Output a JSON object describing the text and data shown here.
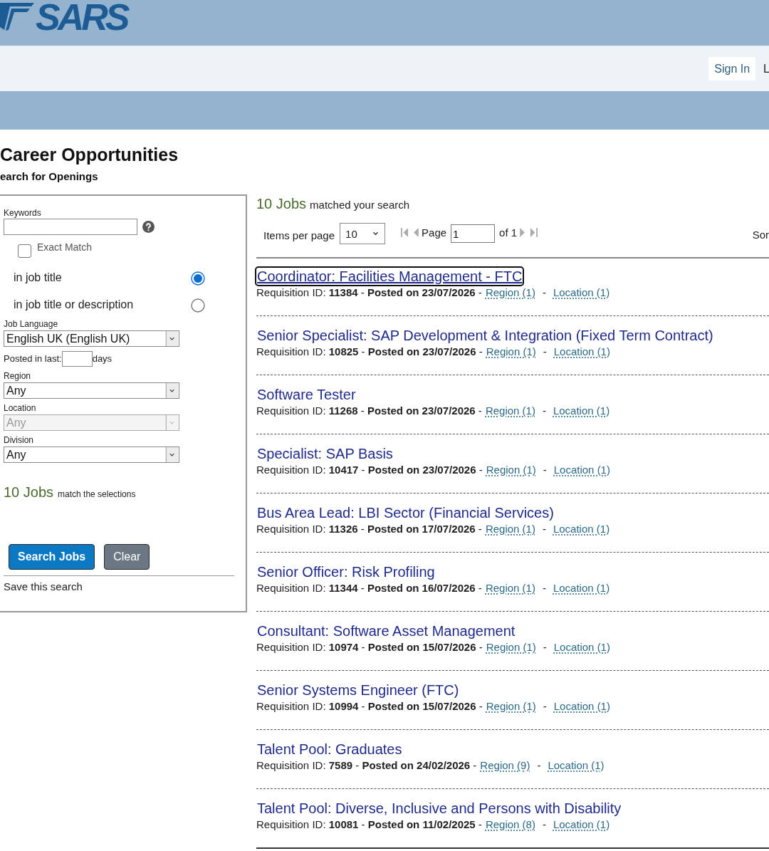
{
  "header": {
    "logo_text": "SARS"
  },
  "nav": {
    "sign_in": "Sign In",
    "cut_link": "L"
  },
  "page": {
    "title": "Career Opportunities",
    "subtitle": "earch for Openings"
  },
  "search_panel": {
    "keywords_label": "Keywords",
    "exact_match": {
      "label": "Exact Match",
      "checked": false
    },
    "scope_options": [
      {
        "label": "in job title",
        "selected": true
      },
      {
        "label": "in job title or description",
        "selected": false
      }
    ],
    "filters": [
      {
        "kind": "select",
        "label": "Job Language",
        "value": "English UK (English UK)",
        "disabled": false
      },
      {
        "kind": "days",
        "label": "Posted in last:",
        "unit": "days"
      },
      {
        "kind": "select",
        "label": "Region",
        "value": "Any",
        "disabled": false
      },
      {
        "kind": "select",
        "label": "Location",
        "value": "Any",
        "disabled": true
      },
      {
        "kind": "select",
        "label": "Division",
        "value": "Any",
        "disabled": false
      }
    ],
    "match": {
      "count": "10 Jobs",
      "text": "match the selections"
    },
    "buttons": [
      {
        "kind": "primary",
        "label": "Search Jobs"
      },
      {
        "kind": "secondary",
        "label": "Clear"
      }
    ],
    "save_link": "Save this search"
  },
  "results": {
    "count": "10 Jobs",
    "text": "matched your search",
    "pager": {
      "items_label": "Items per page",
      "items_value": "10",
      "page_label": "Page",
      "page_value": "1",
      "total_label": "of 1"
    },
    "sort_label": "Sor",
    "jobs": [
      {
        "title": "Coordinator: Facilities Management - FTC",
        "focused": true,
        "details": "Requisition ID: **11384** - **Posted on 23/07/2026** -",
        "region": "Region (1)",
        "separator": "-",
        "location": "Location (1)"
      },
      {
        "title": "Senior Specialist: SAP Development & Integration (Fixed Term Contract)",
        "focused": false,
        "details": "Requisition ID: **10825** - **Posted on 23/07/2026** -",
        "region": "Region (1)",
        "separator": "-",
        "location": "Location (1)"
      },
      {
        "title": "Software Tester",
        "focused": false,
        "details": "Requisition ID: **11268** - **Posted on 23/07/2026** -",
        "region": "Region (1)",
        "separator": "-",
        "location": "Location (1)"
      },
      {
        "title": "Specialist: SAP Basis",
        "focused": false,
        "details": "Requisition ID: **10417** - **Posted on 23/07/2026** -",
        "region": "Region (1)",
        "separator": "-",
        "location": "Location (1)"
      },
      {
        "title": "Bus Area Lead: LBI Sector (Financial Services)",
        "focused": false,
        "details": "Requisition ID: **11326** - **Posted on 17/07/2026** -",
        "region": "Region (1)",
        "separator": "-",
        "location": "Location (1)"
      },
      {
        "title": "Senior Officer: Risk Profiling",
        "focused": false,
        "details": "Requisition ID: **11344** - **Posted on 16/07/2026** -",
        "region": "Region (1)",
        "separator": "-",
        "location": "Location (1)"
      },
      {
        "title": "Consultant: Software Asset Management",
        "focused": false,
        "details": "Requisition ID: **10974** - **Posted on 15/07/2026** -",
        "region": "Region (1)",
        "separator": "-",
        "location": "Location (1)"
      },
      {
        "title": "Senior Systems Engineer (FTC)",
        "focused": false,
        "details": "Requisition ID: **10994** - **Posted on 15/07/2026** -",
        "region": "Region (1)",
        "separator": "-",
        "location": "Location (1)"
      },
      {
        "title": "Talent Pool: Graduates",
        "focused": false,
        "details": "Requisition ID: **7589** - **Posted on 24/02/2026** -",
        "region": "Region (9)",
        "separator": "-",
        "location": "Location (1)"
      },
      {
        "title": "Talent Pool: Diverse, Inclusive and Persons with Disability",
        "focused": false,
        "details": "Requisition ID: **10081** - **Posted on 11/02/2025** -",
        "region": "Region (8)",
        "separator": "-",
        "location": "Location (1)"
      }
    ]
  }
}
